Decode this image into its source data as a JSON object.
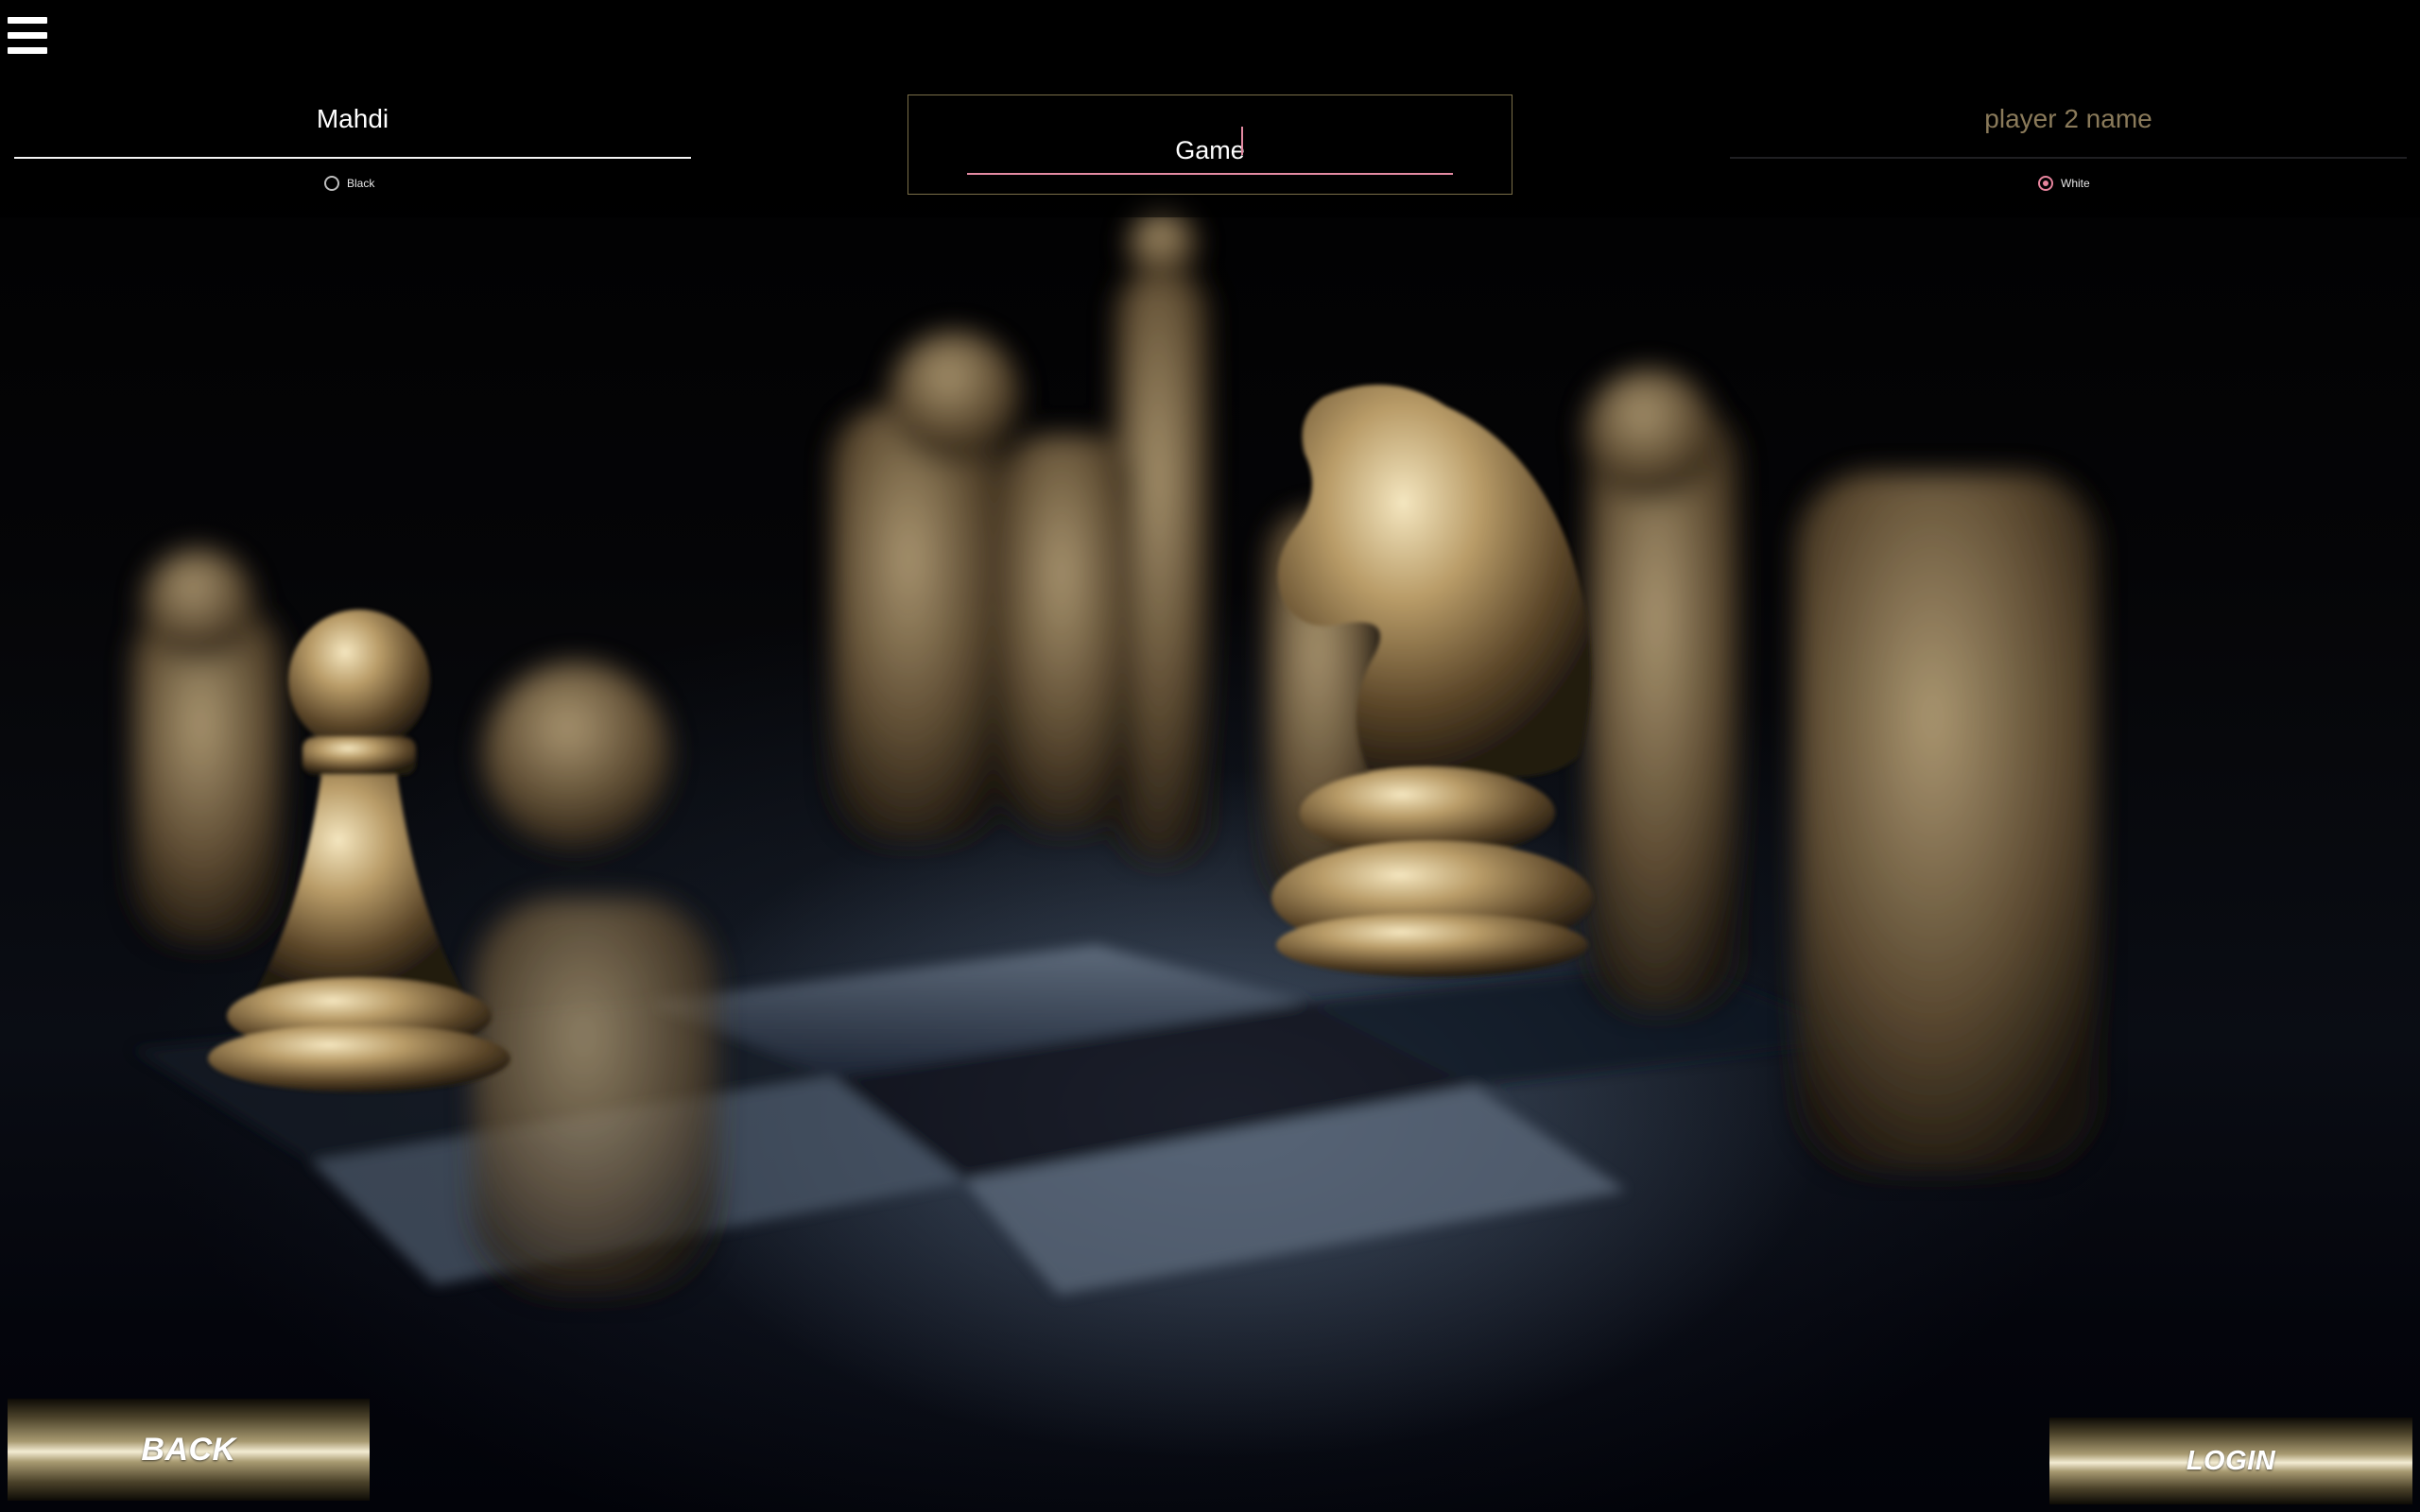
{
  "topbar": {
    "menu_icon": "hamburger-menu-icon"
  },
  "player1": {
    "name_value": "Mahdi",
    "color_option_label": "Black",
    "color_selected": false
  },
  "game": {
    "name_value": "Game"
  },
  "player2": {
    "name_placeholder": "player 2 name",
    "name_value": "",
    "color_option_label": "White",
    "color_selected": true
  },
  "buttons": {
    "back_label": "BACK",
    "login_label": "LOGIN"
  },
  "colors": {
    "accent_pink": "#e38aa2",
    "gold": "#c8b88a",
    "placeholder_gold": "#8a7a5a",
    "background": "#020205"
  }
}
